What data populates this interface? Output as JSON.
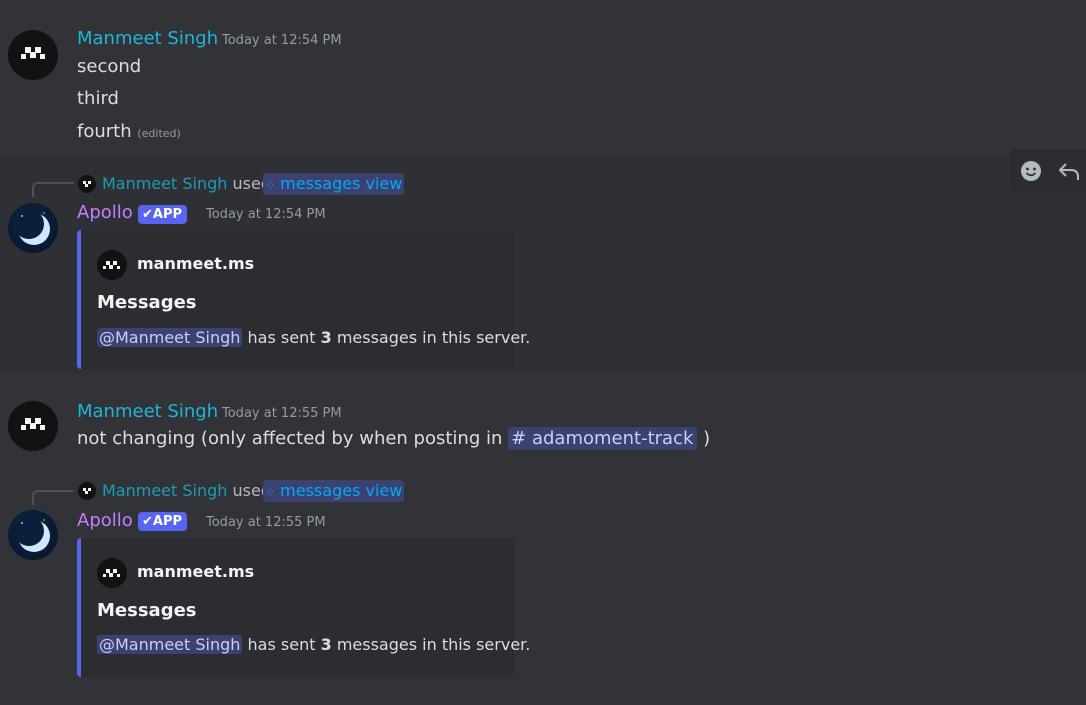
{
  "messages": [
    {
      "username": "Manmeet Singh",
      "timestamp": "Today at 12:54 PM",
      "lines": [
        "second",
        "third",
        "fourth"
      ],
      "edited_label": "(edited)"
    },
    {
      "reply": {
        "username": "Manmeet Singh",
        "used": "used",
        "command": "messages view"
      },
      "username": "Apollo",
      "badge": "APP",
      "timestamp": "Today at 12:54 PM",
      "embed": {
        "author": "manmeet.ms",
        "title": "Messages",
        "mention": "@Manmeet Singh",
        "text_before_count": "has sent",
        "count": "3",
        "text_after_count": "messages in this server."
      }
    },
    {
      "username": "Manmeet Singh",
      "timestamp": "Today at 12:55 PM",
      "text": "not changing (only affected by when posting in",
      "channel": "adamoment-track",
      "text_after": ")"
    },
    {
      "reply": {
        "username": "Manmeet Singh",
        "used": "used",
        "command": "messages view"
      },
      "username": "Apollo",
      "badge": "APP",
      "timestamp": "Today at 12:55 PM",
      "embed": {
        "author": "manmeet.ms",
        "title": "Messages",
        "mention": "@Manmeet Singh",
        "text_before_count": "has sent",
        "count": "3",
        "text_after_count": "messages in this server."
      }
    }
  ],
  "toolbar": {
    "icons": [
      "add-reaction-icon",
      "reply-icon"
    ]
  },
  "colors": {
    "accent": "#5865f2",
    "username_manmeet": "#1fb6d6",
    "username_apollo": "#c77dff",
    "link": "#00a8fc"
  }
}
